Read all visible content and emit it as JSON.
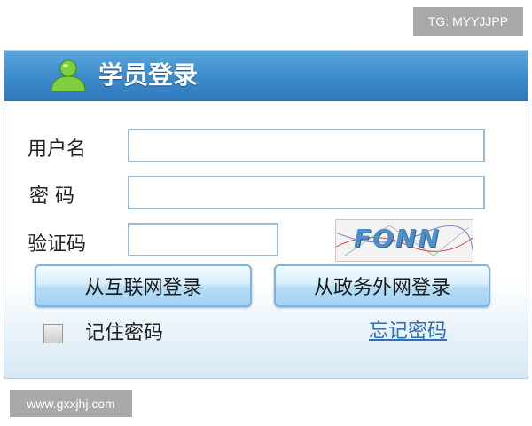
{
  "watermarks": {
    "top_right": "TG: MYYJJPP",
    "bottom_left": "www.gxxjhj.com"
  },
  "header": {
    "title": "学员登录",
    "icon": "user-icon"
  },
  "form": {
    "username_label": "用户名",
    "username_value": "",
    "password_label": "密 码",
    "password_value": "",
    "captcha_label": "验证码",
    "captcha_value": "",
    "captcha_image_text": "FONN"
  },
  "buttons": {
    "internet_login": "从互联网登录",
    "gov_extranet_login": "从政务外网登录"
  },
  "options": {
    "remember_password": "记住密码",
    "remember_checked": false,
    "forgot_password": "忘记密码"
  },
  "colors": {
    "header_blue": "#3e8ccd",
    "link_blue": "#2f6fb3",
    "button_light_blue": "#b5dcf6"
  }
}
